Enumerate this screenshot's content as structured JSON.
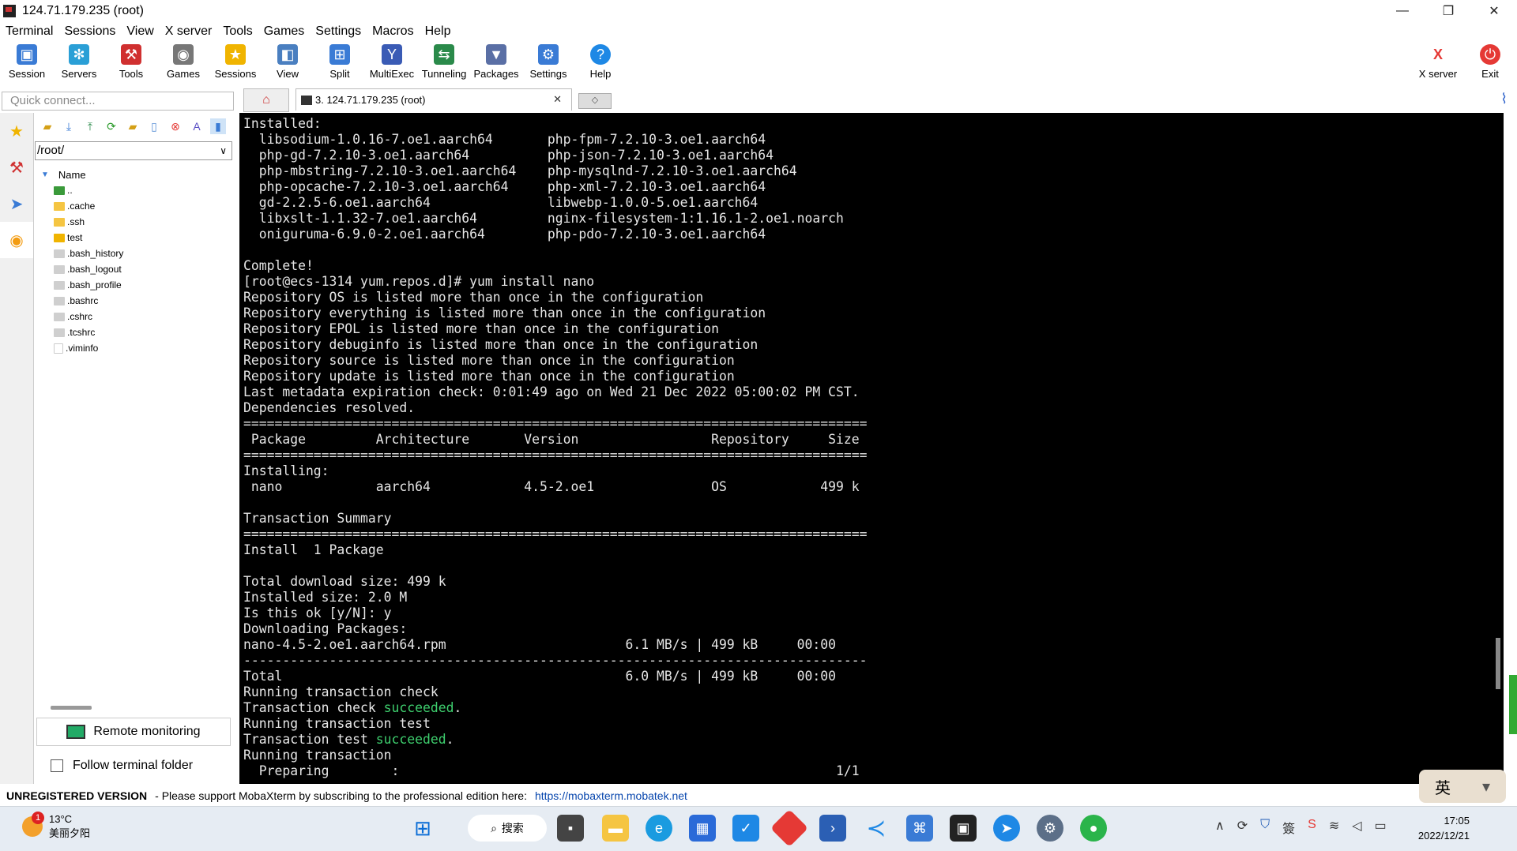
{
  "window": {
    "title": "124.71.179.235 (root)",
    "minimize": "—",
    "maximize": "❐",
    "close": "✕"
  },
  "menu": [
    "Terminal",
    "Sessions",
    "View",
    "X server",
    "Tools",
    "Games",
    "Settings",
    "Macros",
    "Help"
  ],
  "toolbar": {
    "left": [
      {
        "label": "Session",
        "icon": "session-icon",
        "color": "#3a7bd5"
      },
      {
        "label": "Servers",
        "icon": "servers-icon",
        "color": "#2a9fd6"
      },
      {
        "label": "Tools",
        "icon": "tools-icon",
        "color": "#d03030"
      },
      {
        "label": "Games",
        "icon": "games-icon",
        "color": "#777777"
      },
      {
        "label": "Sessions",
        "icon": "star-icon",
        "color": "#f0b400"
      },
      {
        "label": "View",
        "icon": "view-icon",
        "color": "#4a7fc0"
      },
      {
        "label": "Split",
        "icon": "split-icon",
        "color": "#3a7bd5"
      },
      {
        "label": "MultiExec",
        "icon": "multiexec-icon",
        "color": "#3a5bb5"
      },
      {
        "label": "Tunneling",
        "icon": "tunneling-icon",
        "color": "#2a8a4a"
      },
      {
        "label": "Packages",
        "icon": "packages-icon",
        "color": "#5a6fa5"
      },
      {
        "label": "Settings",
        "icon": "settings-icon",
        "color": "#3a7bd5"
      },
      {
        "label": "Help",
        "icon": "help-icon",
        "color": "#1e88e5"
      }
    ],
    "right": [
      {
        "label": "X server",
        "icon": "xserver-icon",
        "color": "#e53935"
      },
      {
        "label": "Exit",
        "icon": "power-icon",
        "color": "#e53935"
      }
    ]
  },
  "quick_connect": {
    "placeholder": "Quick connect..."
  },
  "tabs": {
    "active_label": "3. 124.71.179.235 (root)"
  },
  "sidebar": {
    "path": "/root/",
    "column_header": "Name",
    "files": [
      {
        "name": "..",
        "kind": "up"
      },
      {
        "name": ".cache",
        "kind": "folder"
      },
      {
        "name": ".ssh",
        "kind": "folder"
      },
      {
        "name": "test",
        "kind": "folder"
      },
      {
        "name": ".bash_history",
        "kind": "file"
      },
      {
        "name": ".bash_logout",
        "kind": "file"
      },
      {
        "name": ".bash_profile",
        "kind": "file"
      },
      {
        "name": ".bashrc",
        "kind": "file"
      },
      {
        "name": ".cshrc",
        "kind": "file"
      },
      {
        "name": ".tcshrc",
        "kind": "file"
      },
      {
        "name": ".viminfo",
        "kind": "doc"
      }
    ],
    "remote_monitoring": "Remote monitoring",
    "follow_folder": "Follow terminal folder"
  },
  "terminal": {
    "lines": [
      "Installed:",
      "  libsodium-1.0.16-7.oe1.aarch64       php-fpm-7.2.10-3.oe1.aarch64",
      "  php-gd-7.2.10-3.oe1.aarch64          php-json-7.2.10-3.oe1.aarch64",
      "  php-mbstring-7.2.10-3.oe1.aarch64    php-mysqlnd-7.2.10-3.oe1.aarch64",
      "  php-opcache-7.2.10-3.oe1.aarch64     php-xml-7.2.10-3.oe1.aarch64",
      "  gd-2.2.5-6.oe1.aarch64               libwebp-1.0.0-5.oe1.aarch64",
      "  libxslt-1.1.32-7.oe1.aarch64         nginx-filesystem-1:1.16.1-2.oe1.noarch",
      "  oniguruma-6.9.0-2.oe1.aarch64        php-pdo-7.2.10-3.oe1.aarch64",
      "",
      "Complete!",
      "[root@ecs-1314 yum.repos.d]# yum install nano",
      "Repository OS is listed more than once in the configuration",
      "Repository everything is listed more than once in the configuration",
      "Repository EPOL is listed more than once in the configuration",
      "Repository debuginfo is listed more than once in the configuration",
      "Repository source is listed more than once in the configuration",
      "Repository update is listed more than once in the configuration",
      "Last metadata expiration check: 0:01:49 ago on Wed 21 Dec 2022 05:00:02 PM CST.",
      "Dependencies resolved.",
      "================================================================================",
      " Package         Architecture       Version                 Repository     Size",
      "================================================================================",
      "Installing:",
      " nano            aarch64            4.5-2.oe1               OS            499 k",
      "",
      "Transaction Summary",
      "================================================================================",
      "Install  1 Package",
      "",
      "Total download size: 499 k",
      "Installed size: 2.0 M",
      "Is this ok [y/N]: y",
      "Downloading Packages:",
      "nano-4.5-2.oe1.aarch64.rpm                       6.1 MB/s | 499 kB     00:00",
      "--------------------------------------------------------------------------------",
      "Total                                            6.0 MB/s | 499 kB     00:00",
      "Running transaction check",
      "Transaction check |succeeded|.",
      "Running transaction test",
      "Transaction test |succeeded|.",
      "Running transaction",
      "  Preparing        :                                                        1/1"
    ]
  },
  "statusbar": {
    "version": "UNREGISTERED VERSION",
    "message": "-  Please support MobaXterm by subscribing to the professional edition here:",
    "link": "https://mobaxterm.mobatek.net"
  },
  "ime": {
    "lang": "英",
    "icon": "shirt-icon"
  },
  "taskbar": {
    "weather_temp": "13°C",
    "weather_text": "美丽夕阳",
    "badge": "1",
    "search": "搜索",
    "tray_char": "簽",
    "time": "17:05",
    "date": "2022/12/21"
  },
  "colors": {
    "success_green": "#3ecf6e",
    "terminal_bg": "#000000",
    "link_blue": "#0645ad"
  }
}
